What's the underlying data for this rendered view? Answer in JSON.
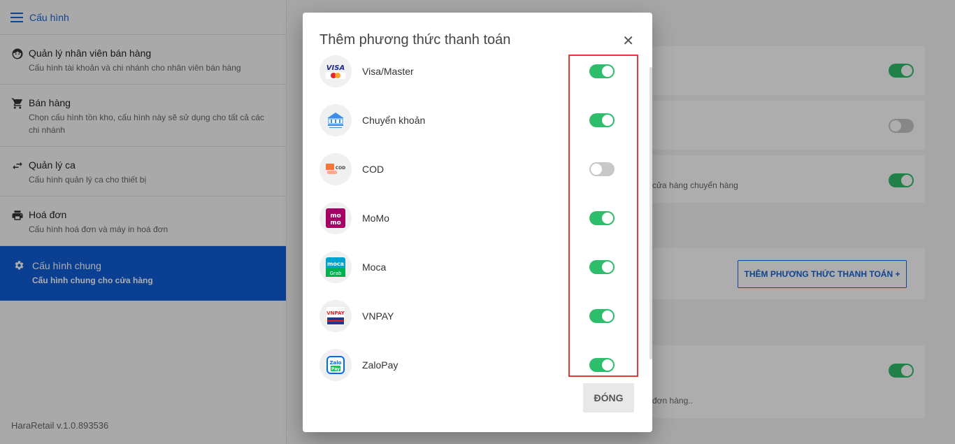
{
  "sidebar": {
    "header": "Cấu hình",
    "items": [
      {
        "title": "Quản lý nhân viên bán hàng",
        "subtitle": "Cấu hình tài khoản và chi nhánh cho nhân viên bán hàng",
        "icon": "face-icon"
      },
      {
        "title": "Bán hàng",
        "subtitle": "Chọn cấu hình tồn kho, cấu hình này sẽ sử dụng cho tất cả các chi nhánh",
        "icon": "cart-icon"
      },
      {
        "title": "Quản lý ca",
        "subtitle": "Cấu hình quản lý ca cho thiết bị",
        "icon": "swap-icon"
      },
      {
        "title": "Hoá đơn",
        "subtitle": "Cấu hình hoá đơn và máy in hoá đơn",
        "icon": "printer-icon"
      },
      {
        "title": "Cấu hình chung",
        "subtitle": "Cấu hình chung cho cửa hàng",
        "icon": "gear-icon",
        "active": true
      }
    ],
    "version": "HaraRetail v.1.0.893536"
  },
  "background": {
    "card3_text": "cửa hàng chuyển hàng",
    "add_payment_button": "THÊM PHƯƠNG THỨC THANH TOÁN +",
    "card5_text": "đơn hàng..",
    "toggles": [
      true,
      false,
      true,
      true
    ]
  },
  "modal": {
    "title": "Thêm phương thức thanh toán",
    "close_label": "ĐÓNG",
    "methods": [
      {
        "name": "Visa/Master",
        "enabled": true
      },
      {
        "name": "Chuyển khoản",
        "enabled": true
      },
      {
        "name": "COD",
        "enabled": false
      },
      {
        "name": "MoMo",
        "enabled": true
      },
      {
        "name": "Moca",
        "enabled": true
      },
      {
        "name": "VNPAY",
        "enabled": true
      },
      {
        "name": "ZaloPay",
        "enabled": true
      }
    ]
  },
  "colors": {
    "accent": "#0f5ed7",
    "toggle_on": "#2ebd6b",
    "toggle_off": "#c8c8c8",
    "highlight": "#e53935"
  }
}
